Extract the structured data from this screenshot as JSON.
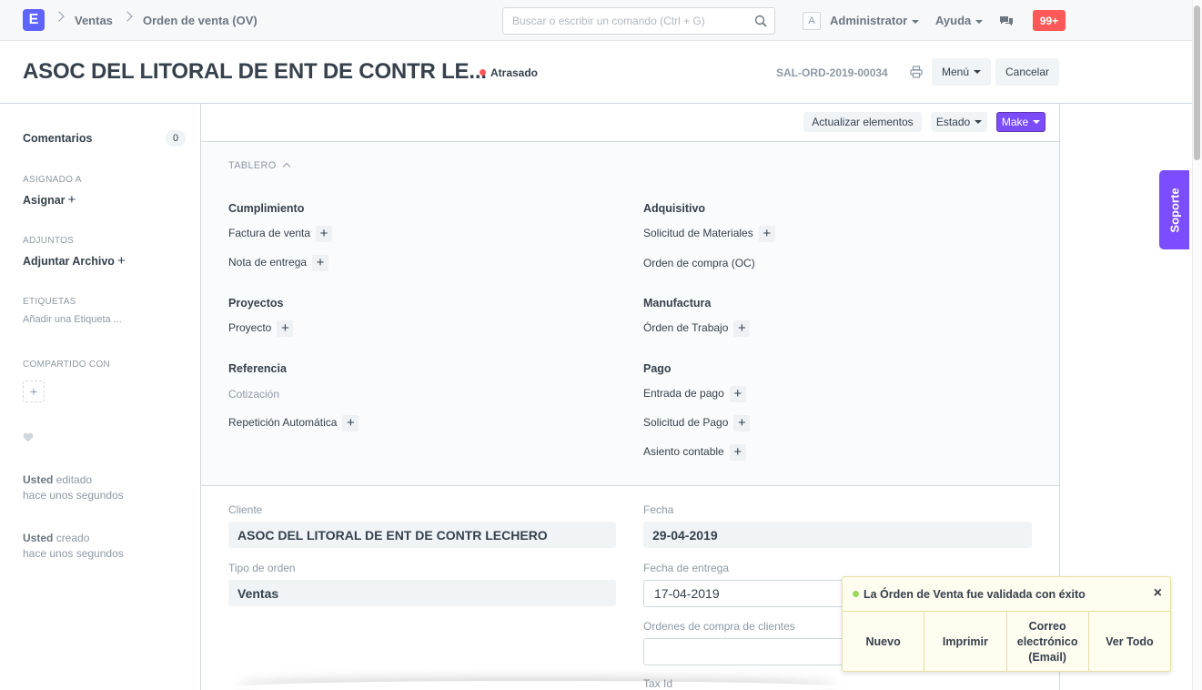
{
  "navbar": {
    "logo_letter": "E",
    "breadcrumbs": [
      "Ventas",
      "Orden de venta (OV)"
    ],
    "search_placeholder": "Buscar o escribir un comando (Ctrl + G)",
    "avatar_letter": "A",
    "user_label": "Administrator",
    "help_label": "Ayuda",
    "notifications": "99+"
  },
  "page": {
    "title": "ASOC DEL LITORAL DE ENT DE CONTR LE...",
    "status": "Atrasado",
    "doc_id": "SAL-ORD-2019-00034",
    "menu_label": "Menú",
    "cancel_label": "Cancelar"
  },
  "sidebar": {
    "comments_label": "Comentarios",
    "comments_count": "0",
    "assigned_heading": "ASIGNADO A",
    "assign_label": "Asignar",
    "attachments_heading": "ADJUNTOS",
    "attach_label": "Adjuntar Archivo",
    "tags_heading": "ETIQUETAS",
    "add_tag_label": "Añadir una Etiqueta ...",
    "shared_heading": "COMPARTIDO CON",
    "timeline": [
      {
        "who": "Usted",
        "action": "editado",
        "when": "hace unos segundos"
      },
      {
        "who": "Usted",
        "action": "creado",
        "when": "hace unos segundos"
      }
    ]
  },
  "toolbar": {
    "update_items": "Actualizar elementos",
    "status": "Estado",
    "make": "Make"
  },
  "dashboard": {
    "heading": "TABLERO",
    "left_groups": [
      {
        "title": "Cumplimiento",
        "links": [
          {
            "label": "Factura de venta",
            "plus": true
          },
          {
            "label": "Nota de entrega",
            "plus": true
          }
        ]
      },
      {
        "title": "Proyectos",
        "links": [
          {
            "label": "Proyecto",
            "plus": true
          }
        ]
      },
      {
        "title": "Referencia",
        "links": [
          {
            "label": "Cotización",
            "plus": false
          },
          {
            "label": "Repetición Automática",
            "plus": true
          }
        ]
      }
    ],
    "right_groups": [
      {
        "title": "Adquisitivo",
        "links": [
          {
            "label": "Solicitud de Materiales",
            "plus": true
          },
          {
            "label": "Orden de compra (OC)",
            "plus": false
          }
        ]
      },
      {
        "title": "Manufactura",
        "links": [
          {
            "label": "Órden de Trabajo",
            "plus": true
          }
        ]
      },
      {
        "title": "Pago",
        "links": [
          {
            "label": "Entrada de pago",
            "plus": true
          },
          {
            "label": "Solicitud de Pago",
            "plus": true
          },
          {
            "label": "Asiento contable",
            "plus": true
          }
        ]
      }
    ]
  },
  "form": {
    "customer_label": "Cliente",
    "customer_value": "ASOC DEL LITORAL DE ENT DE CONTR LECHERO",
    "order_type_label": "Tipo de orden",
    "order_type_value": "Ventas",
    "date_label": "Fecha",
    "date_value": "29-04-2019",
    "delivery_label": "Fecha de entrega",
    "delivery_value": "17-04-2019",
    "po_label": "Ordenes de compra de clientes",
    "po_value": "",
    "tax_label": "Tax Id"
  },
  "support": {
    "label": "Soporte"
  },
  "toast": {
    "message": "La Órden de Venta fue validada con éxito",
    "close": "×",
    "actions": [
      "Nuevo",
      "Imprimir",
      "Correo electrónico (Email)",
      "Ver Todo"
    ]
  }
}
